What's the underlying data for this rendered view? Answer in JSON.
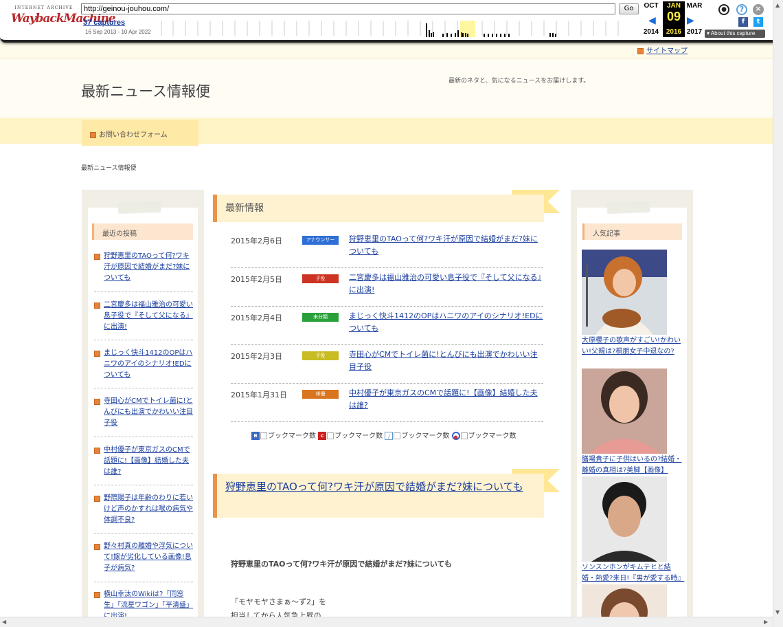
{
  "wayback": {
    "logo_top": "INTERNET ARCHIVE",
    "logo_main": "WaybackMachine",
    "url": "http://geinou-jouhou.com/",
    "go": "Go",
    "captures": "37 captures",
    "range": "16 Sep 2013 - 10 Apr 2022",
    "months": [
      {
        "month": "OCT",
        "day": "",
        "year": "2014"
      },
      {
        "month": "JAN",
        "day": "09",
        "year": "2016"
      },
      {
        "month": "MAR",
        "day": "",
        "year": "2017"
      }
    ],
    "about": "About this capture",
    "icons": [
      "user-icon",
      "help-icon",
      "close-icon",
      "facebook-icon",
      "twitter-icon"
    ]
  },
  "site": {
    "sitemap": "サイトマップ",
    "title": "最新ニュース情報便",
    "tagline": "最新のネタと、気になるニュースをお届けします。",
    "nav_contact": "お問い合わせフォーム",
    "breadcrumb": "最新ニュース情報便"
  },
  "left_sidebar": {
    "heading": "最近の投稿",
    "posts": [
      "狩野恵里のTAOって何?ワキ汗が原因で結婚がまだ?妹についても",
      "二宮慶多は福山雅治の可愛い息子役で『そして父になる』に出演!",
      "まじっく快斗1412のOPはハニワのアイのシナリオ!EDについても",
      "寺田心がCMでトイレ菌に!とんびにも出演でかわいい注目子役",
      "中村優子が東京ガスのCMで話題に!【画像】結婚した夫は誰?",
      "野際陽子は年齢のわりに若いけど声のかすれは喉の病気や体調不良?",
      "野々村真の離婚や浮気について!嫁が劣化している画像!息子が病気?",
      "横山幸汰のWikiは?「同窓生」「流星ワゴン」「平清盛」に出演!"
    ]
  },
  "main": {
    "latest_heading": "最新情報",
    "news": [
      {
        "date": "2015年2月6日",
        "badge": "アナウンサー",
        "color": "#2f6fd6",
        "title": "狩野恵里のTAOって何?ワキ汗が原因で結婚がまだ?妹についても"
      },
      {
        "date": "2015年2月5日",
        "badge": "子役",
        "color": "#cc3322",
        "title": "二宮慶多は福山雅治の可愛い息子役で『そして父になる』に出演!"
      },
      {
        "date": "2015年2月4日",
        "badge": "未分類",
        "color": "#2aa03a",
        "title": "まじっく快斗1412のOPはハニワのアイのシナリオ!EDについても"
      },
      {
        "date": "2015年2月3日",
        "badge": "子役",
        "color": "#c9bb22",
        "title": "寺田心がCMでトイレ菌に!とんびにも出演でかわいい注目子役"
      },
      {
        "date": "2015年1月31日",
        "badge": "俳優",
        "color": "#d9741f",
        "title": "中村優子が東京ガスのCMで話題に!【画像】結婚した夫は誰?"
      }
    ],
    "bookmark_label": "ブックマーク数",
    "article_title": "狩野恵里のTAOって何?ワキ汗が原因で結婚がまだ?妹についても",
    "article_subtitle": "狩野恵里のTAOって何?ワキ汗が原因で結婚がまだ?妹についても",
    "article_body_1": "「モヤモヤさまぁ～ず2」を",
    "article_body_2": "担当してから人気急上昇の"
  },
  "right_sidebar": {
    "heading": "人気記事",
    "items": [
      "大原櫻子の歌声がすごい!かわいい!父親は?桐朋女子中退なの?",
      "膳場貴子に子供はいるの?結婚・離婚の真相は?美脚【画像】",
      "ソンスンホンがキムテヒと結婚・熱愛?来日!『男が愛する時』"
    ]
  }
}
